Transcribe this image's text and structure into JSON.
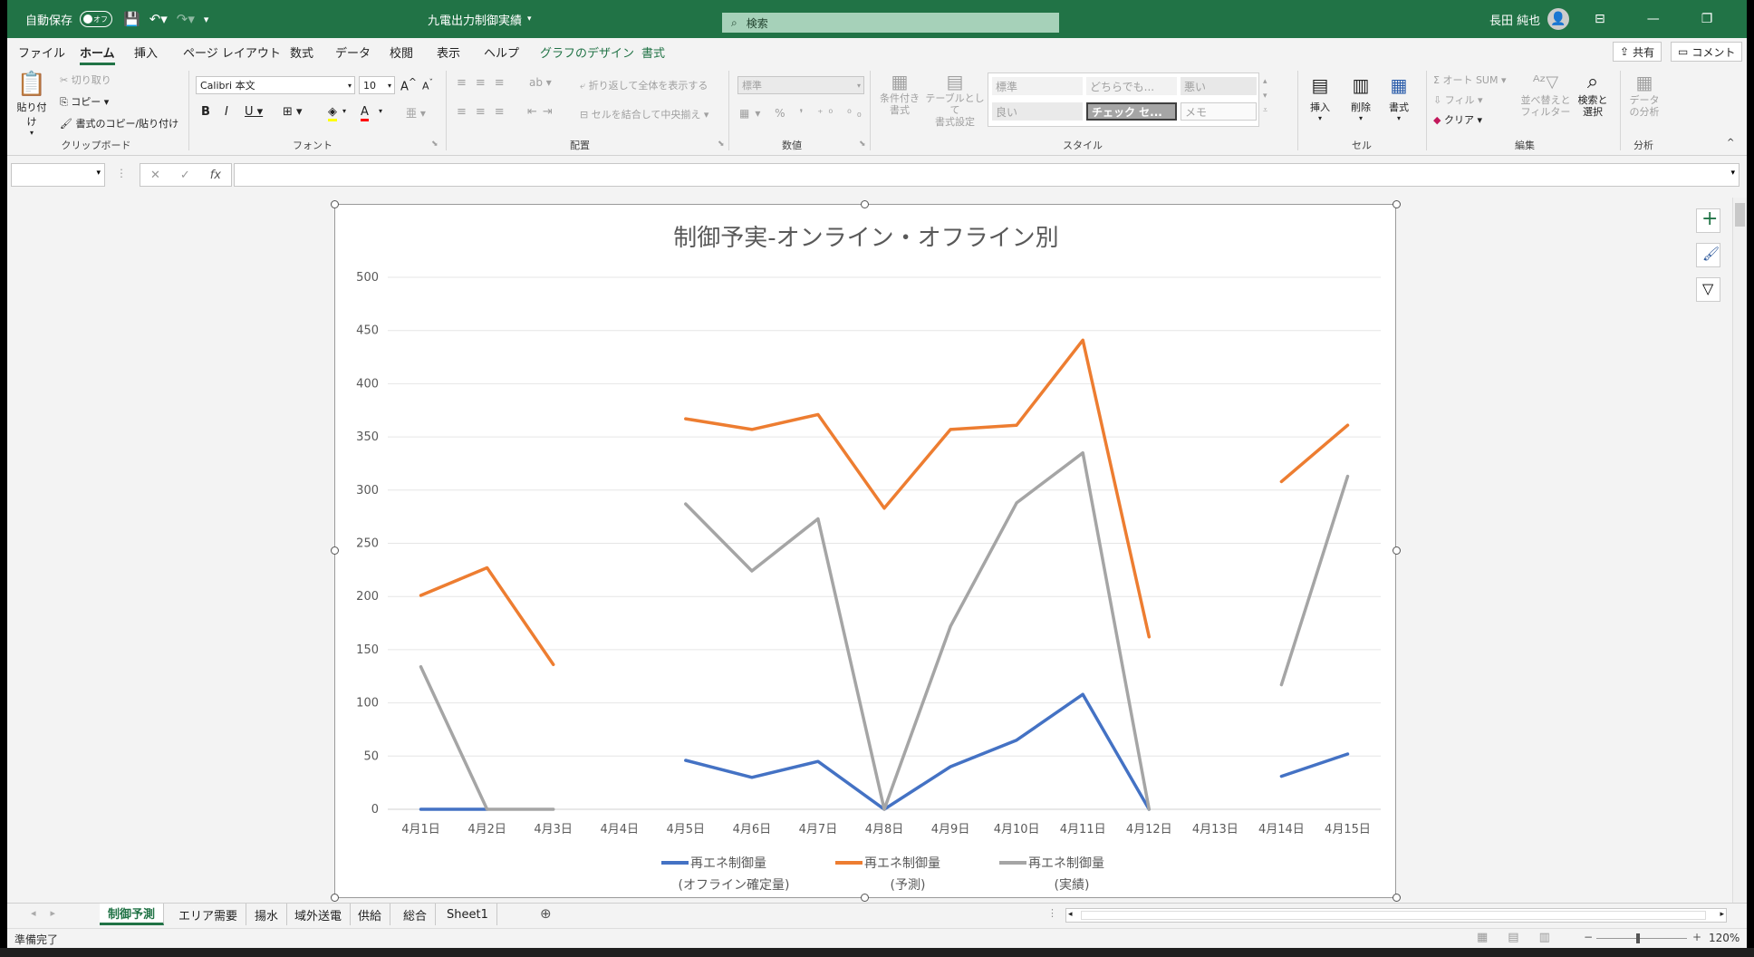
{
  "titlebar": {
    "autosave_label": "自動保存",
    "autosave_state": "オフ",
    "doc_title": "九電出力制御実績",
    "search_placeholder": "検索",
    "user_name": "長田 純也"
  },
  "menu": {
    "tabs": [
      "ファイル",
      "ホーム",
      "挿入",
      "ページ レイアウト",
      "数式",
      "データ",
      "校閲",
      "表示",
      "ヘルプ",
      "グラフのデザイン",
      "書式"
    ],
    "share_label": "共有",
    "comment_label": "コメント"
  },
  "ribbon": {
    "clipboard": {
      "label": "クリップボード",
      "paste": "貼り付け",
      "cut": "切り取り",
      "copy": "コピー",
      "format_painter": "書式のコピー/貼り付け"
    },
    "font": {
      "label": "フォント",
      "name": "Calibri 本文",
      "size": "10"
    },
    "alignment": {
      "label": "配置",
      "wrap": "折り返して全体を表示する",
      "merge": "セルを結合して中央揃え"
    },
    "number": {
      "label": "数値",
      "format": "標準"
    },
    "styles": {
      "label": "スタイル",
      "cond_format_1": "条件付き",
      "cond_format_2": "書式",
      "table_format_1": "テーブルとして",
      "table_format_2": "書式設定",
      "cells": [
        "標準",
        "どちらでも...",
        "悪い",
        "良い",
        "チェック セ...",
        "メモ"
      ]
    },
    "cells": {
      "label": "セル",
      "insert": "挿入",
      "delete": "削除",
      "format": "書式"
    },
    "editing": {
      "label": "編集",
      "autosum": "オート SUM",
      "fill": "フィル",
      "clear": "クリア",
      "sort_1": "並べ替えと",
      "sort_2": "フィルター",
      "find_1": "検索と",
      "find_2": "選択"
    },
    "analysis": {
      "label": "分析",
      "data_1": "データ",
      "data_2": "の分析"
    }
  },
  "chart_data": {
    "type": "line",
    "title": "制御予実-オンライン・オフライン別",
    "categories": [
      "4月1日",
      "4月2日",
      "4月3日",
      "4月4日",
      "4月5日",
      "4月6日",
      "4月7日",
      "4月8日",
      "4月9日",
      "4月10日",
      "4月11日",
      "4月12日",
      "4月13日",
      "4月14日",
      "4月15日"
    ],
    "ylim": [
      0,
      500
    ],
    "yticks": [
      0,
      50,
      100,
      150,
      200,
      250,
      300,
      350,
      400,
      450,
      500
    ],
    "grid": true,
    "legend_position": "bottom",
    "series": [
      {
        "name_1": "再エネ制御量",
        "name_2": "(オフライン確定量)",
        "color": "#4472c4",
        "values": [
          0,
          0,
          null,
          null,
          46,
          30,
          45,
          0,
          40,
          65,
          108,
          0,
          null,
          31,
          52
        ]
      },
      {
        "name_1": "再エネ制御量",
        "name_2": "(予測)",
        "color": "#ed7d31",
        "values": [
          201,
          227,
          136,
          null,
          367,
          357,
          371,
          283,
          357,
          361,
          441,
          162,
          null,
          308,
          361
        ]
      },
      {
        "name_1": "再エネ制御量",
        "name_2": "(実績)",
        "color": "#a5a5a5",
        "values": [
          134,
          0,
          0,
          null,
          287,
          224,
          273,
          0,
          172,
          288,
          335,
          0,
          null,
          117,
          313
        ]
      }
    ]
  },
  "sheets": {
    "tabs": [
      "制御予測",
      "エリア需要",
      "揚水",
      "域外送電",
      "供給",
      "総合",
      "Sheet1"
    ],
    "active": 0
  },
  "status": {
    "ready": "準備完了",
    "zoom": "120%"
  }
}
